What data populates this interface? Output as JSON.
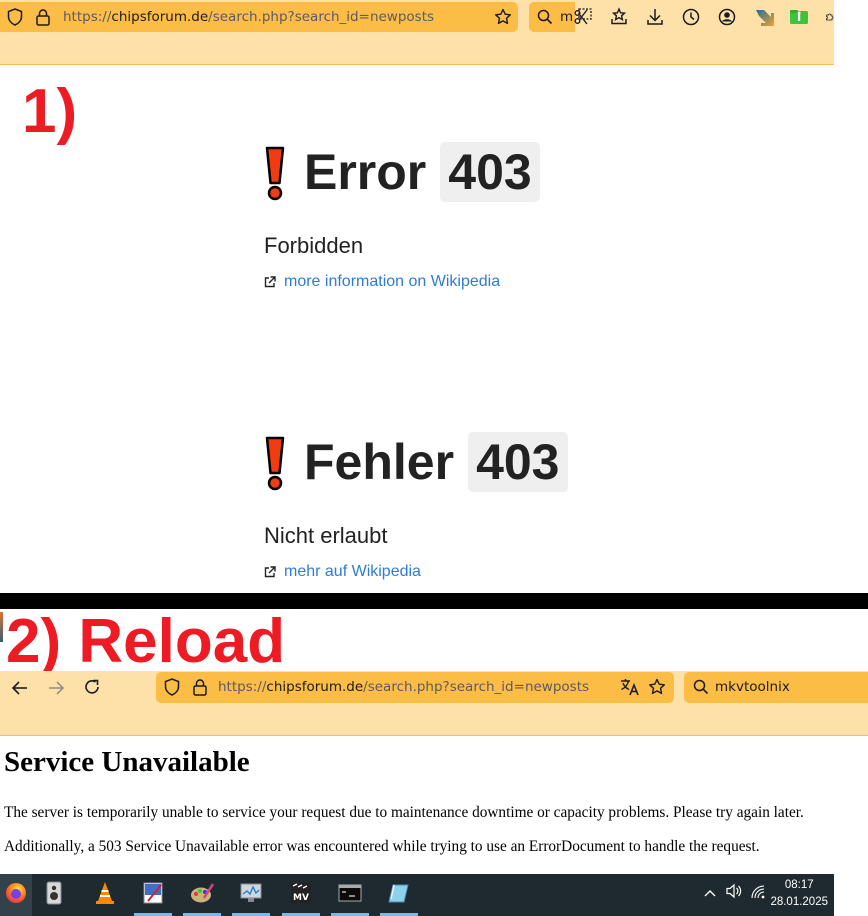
{
  "screenshot1": {
    "label": "1)",
    "browser": {
      "url_prefix": "https://",
      "url_host": "chipsforum.de",
      "url_path": "/search.php?search_id=newposts",
      "search_partial": "m",
      "toolbar_icons": [
        "screenshot-icon",
        "pocket-icon",
        "download-icon",
        "history-icon",
        "account-icon",
        "extension-arrow-icon",
        "extension-green-icon",
        "extensions-puzzle-icon"
      ]
    },
    "errors": [
      {
        "title": "Error",
        "code": "403",
        "subtitle": "Forbidden",
        "link": "more information on Wikipedia"
      },
      {
        "title": "Fehler",
        "code": "403",
        "subtitle": "Nicht erlaubt",
        "link": "mehr auf Wikipedia"
      }
    ]
  },
  "screenshot2": {
    "label": "2) Reload",
    "browser": {
      "url_prefix": "https://",
      "url_host": "chipsforum.de",
      "url_path": "/search.php?search_id=newposts",
      "search_value": "mkvtoolnix"
    },
    "page": {
      "title": "Service Unavailable",
      "paragraph1": "The server is temporarily unable to service your request due to maintenance downtime or capacity problems. Please try again later.",
      "paragraph2": "Additionally, a 503 Service Unavailable error was encountered while trying to use an ErrorDocument to handle the request."
    }
  },
  "taskbar": {
    "apps": [
      "Firefox",
      "Speaker",
      "VLC",
      "Paint",
      "Art",
      "Monitor",
      "MKV",
      "Terminal",
      "Notepad"
    ],
    "time": "08:17",
    "date": "28.01.2025"
  }
}
